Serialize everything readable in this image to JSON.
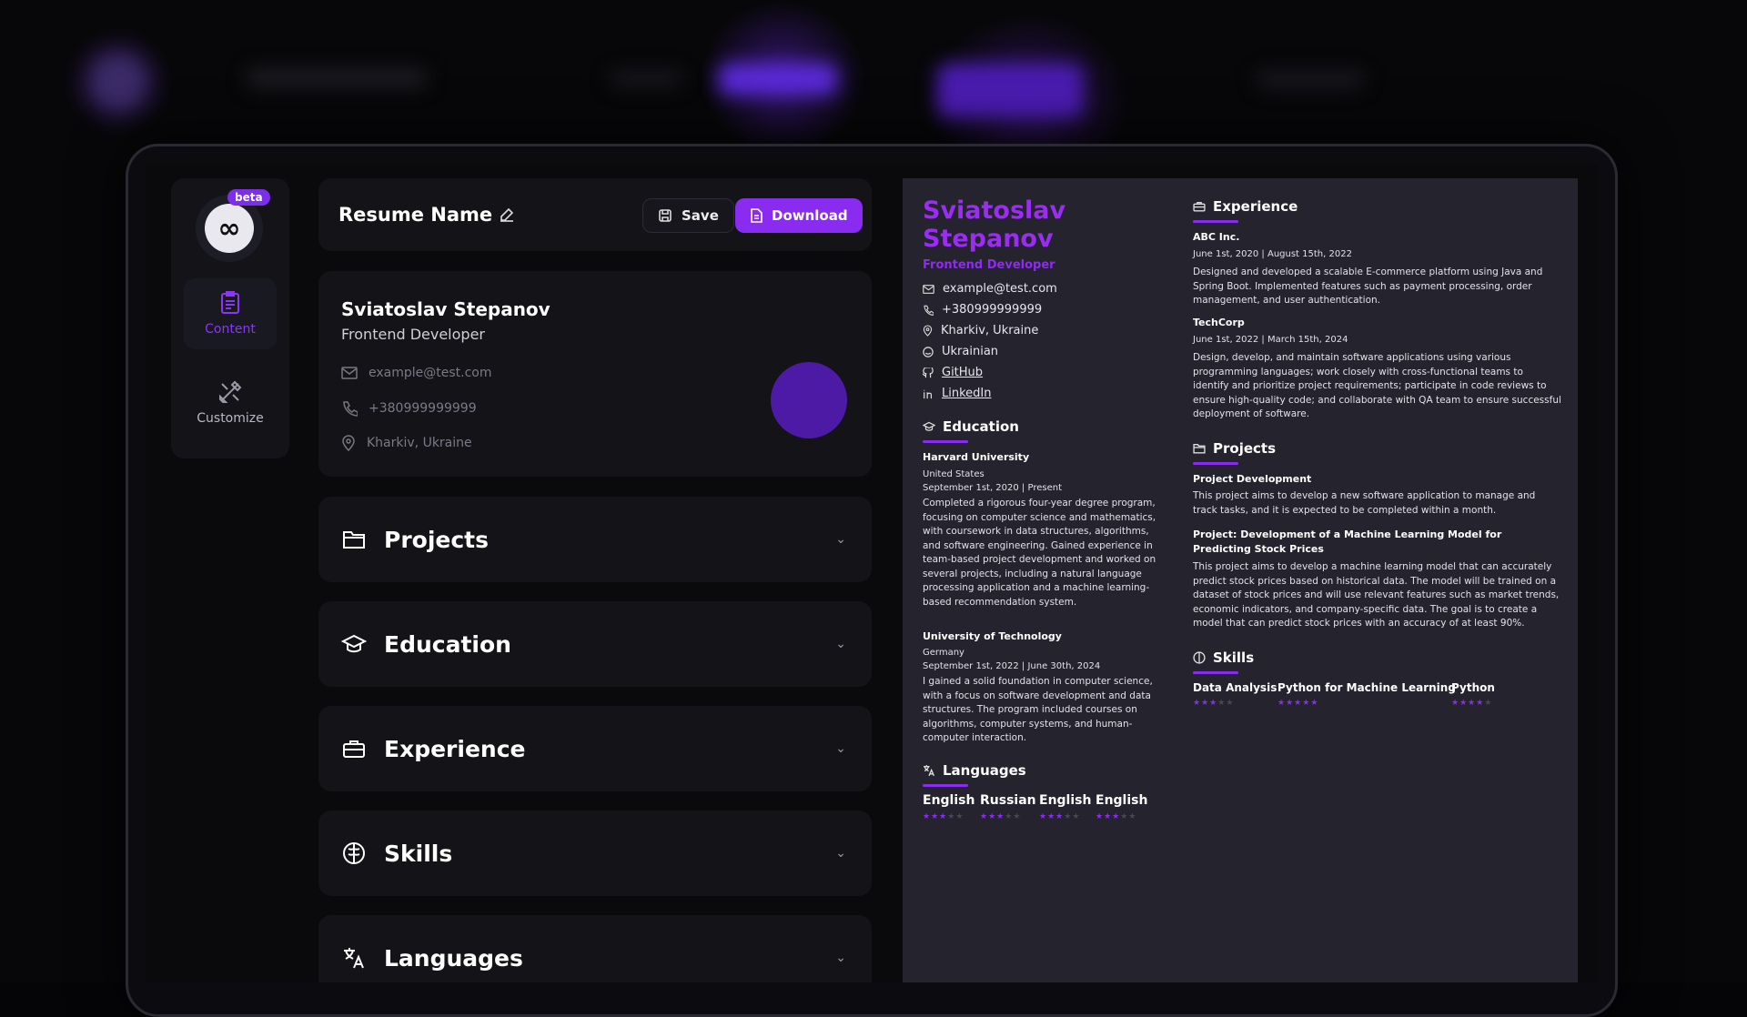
{
  "app": {
    "logo_badge": "beta",
    "nav": [
      {
        "label": "Content",
        "icon": "clipboard-icon",
        "active": true
      },
      {
        "label": "Customize",
        "icon": "tools-icon",
        "active": false
      }
    ],
    "accent": "#8a2cf0"
  },
  "toolbar": {
    "resume_name": "Resume Name",
    "save_label": "Save",
    "download_label": "Download"
  },
  "profile": {
    "name": "Sviatoslav Stepanov",
    "title": "Frontend Developer",
    "email": "example@test.com",
    "phone": "+380999999999",
    "location": "Kharkiv, Ukraine"
  },
  "sections": [
    {
      "label": "Projects",
      "icon": "folder-icon"
    },
    {
      "label": "Education",
      "icon": "graduation-cap-icon"
    },
    {
      "label": "Experience",
      "icon": "briefcase-icon"
    },
    {
      "label": "Skills",
      "icon": "brain-icon"
    },
    {
      "label": "Languages",
      "icon": "translate-icon"
    }
  ],
  "preview": {
    "name": "Sviatoslav Stepanov",
    "title": "Frontend Developer",
    "contacts": {
      "email": "example@test.com",
      "phone": "+380999999999",
      "location": "Kharkiv, Ukraine",
      "nationality": "Ukrainian",
      "github": "GitHub",
      "linkedin": "LinkedIn"
    },
    "education": {
      "heading": "Education",
      "items": [
        {
          "school": "Harvard University",
          "country": "United States",
          "dates": "September 1st, 2020 | Present",
          "description": "Completed a rigorous four-year degree program, focusing on computer science and mathematics, with coursework in data structures, algorithms, and software engineering. Gained experience in team-based project development and worked on several projects, including a natural language processing application and a machine learning-based recommendation system."
        },
        {
          "school": "University of Technology",
          "country": "Germany",
          "dates": "September 1st, 2022 | June 30th, 2024",
          "description": "I gained a solid foundation in computer science, with a focus on software development and data structures. The program included courses on algorithms, computer systems, and human-computer interaction."
        }
      ]
    },
    "languages": {
      "heading": "Languages",
      "items": [
        {
          "name": "English",
          "rating": 3
        },
        {
          "name": "Russian",
          "rating": 3
        },
        {
          "name": "English",
          "rating": 3
        },
        {
          "name": "English",
          "rating": 3
        }
      ]
    },
    "experience": {
      "heading": "Experience",
      "items": [
        {
          "company": "ABC Inc.",
          "dates": "June 1st, 2020 | August 15th, 2022",
          "description": "Designed and developed a scalable E-commerce platform using Java and Spring Boot. Implemented features such as payment processing, order management, and user authentication."
        },
        {
          "company": "TechCorp",
          "dates": "June 1st, 2022 | March 15th, 2024",
          "description": "Design, develop, and maintain software applications using various programming languages; work closely with cross-functional teams to identify and prioritize project requirements; participate in code reviews to ensure high-quality code; and collaborate with QA team to ensure successful deployment of software."
        }
      ]
    },
    "projects": {
      "heading": "Projects",
      "items": [
        {
          "title": "Project Development",
          "description": "This project aims to develop a new software application to manage and track tasks, and it is expected to be completed within a month."
        },
        {
          "title": "Project: Development of a Machine Learning Model for Predicting Stock Prices",
          "description": "This project aims to develop a machine learning model that can accurately predict stock prices based on historical data. The model will be trained on a dataset of stock prices and will use relevant features such as market trends, economic indicators, and company-specific data. The goal is to create a model that can predict stock prices with an accuracy of at least 90%."
        }
      ]
    },
    "skills": {
      "heading": "Skills",
      "items": [
        {
          "name": "Data Analysis",
          "rating": 3
        },
        {
          "name": "Python for Machine Learning",
          "rating": 5
        },
        {
          "name": "Python",
          "rating": 4
        }
      ]
    }
  }
}
